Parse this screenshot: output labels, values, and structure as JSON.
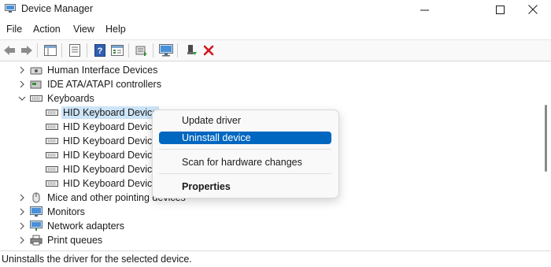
{
  "window": {
    "title": "Device Manager",
    "controls": [
      "minimize",
      "maximize",
      "close"
    ]
  },
  "menubar": {
    "items": [
      "File",
      "Action",
      "View",
      "Help"
    ]
  },
  "toolbar": {
    "buttons": [
      "back-arrow-icon",
      "forward-arrow-icon",
      "properties-sheet-icon",
      "list-view-icon",
      "help-icon",
      "show-hide-console-tree-icon",
      "scan-hardware-icon",
      "monitor-icon",
      "enable-device-icon",
      "uninstall-x-icon"
    ]
  },
  "tree": {
    "rows": [
      {
        "label": "Human Interface Devices",
        "expanded": false,
        "icon": "hid-icon"
      },
      {
        "label": "IDE ATA/ATAPI controllers",
        "expanded": false,
        "icon": "ide-controller-icon"
      },
      {
        "label": "Keyboards",
        "expanded": true,
        "icon": "keyboard-icon"
      },
      {
        "label": "HID Keyboard Device",
        "child": true,
        "selected": true,
        "icon": "keyboard-icon"
      },
      {
        "label": "HID Keyboard Device",
        "child": true,
        "icon": "keyboard-icon"
      },
      {
        "label": "HID Keyboard Device",
        "child": true,
        "icon": "keyboard-icon"
      },
      {
        "label": "HID Keyboard Device",
        "child": true,
        "icon": "keyboard-icon"
      },
      {
        "label": "HID Keyboard Device",
        "child": true,
        "icon": "keyboard-icon"
      },
      {
        "label": "HID Keyboard Device",
        "child": true,
        "icon": "keyboard-icon"
      },
      {
        "label": "Mice and other pointing devices",
        "expanded": false,
        "icon": "mouse-icon"
      },
      {
        "label": "Monitors",
        "expanded": false,
        "icon": "monitor-icon"
      },
      {
        "label": "Network adapters",
        "expanded": false,
        "icon": "network-adapter-icon"
      },
      {
        "label": "Print queues",
        "expanded": false,
        "icon": "printer-icon"
      }
    ]
  },
  "context_menu": {
    "items": [
      {
        "label": "Update driver"
      },
      {
        "label": "Uninstall device",
        "highlighted": true
      },
      {
        "label": "Scan for hardware changes"
      },
      {
        "label": "Properties",
        "bold": true
      }
    ]
  },
  "statusbar": {
    "text": "Uninstalls the driver for the selected device."
  },
  "colors": {
    "accent": "#0067c0",
    "selection": "#cce4f7",
    "delete_red": "#d4161c"
  }
}
